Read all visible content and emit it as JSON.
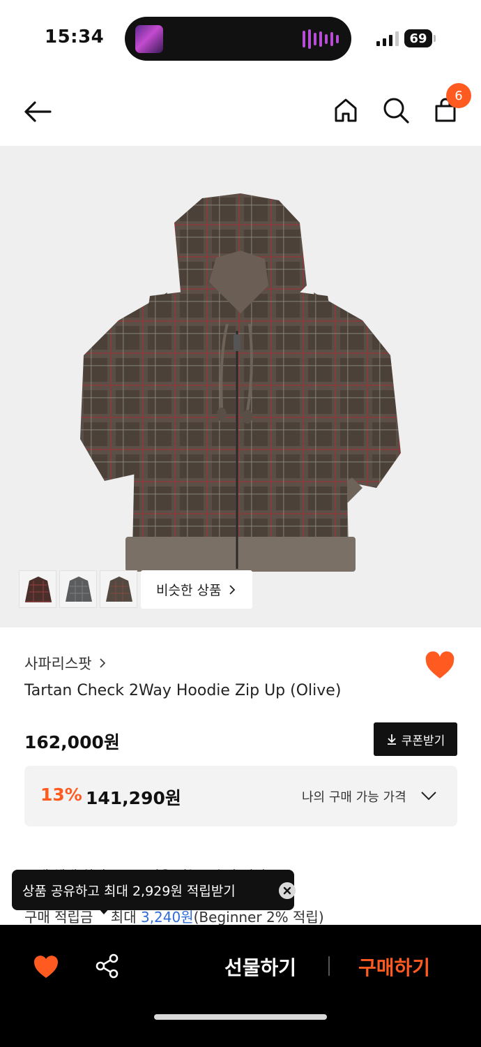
{
  "status": {
    "time": "15:34",
    "battery": "69"
  },
  "nav": {
    "cart_count": "6"
  },
  "gallery": {
    "similar_label": "비슷한 상품"
  },
  "product": {
    "brand": "사파리스팟",
    "title": "Tartan Check 2Way Hoodie Zip Up (Olive)",
    "price": "162,000원",
    "coupon_label": "쿠폰받기",
    "discount_rate": "13%",
    "discount_price": "141,290원",
    "my_price_label": "나의 구매 가능 가격",
    "liked": true
  },
  "benefits": {
    "row1": "구매 혜택    회원 등급 · 적용 가능 · 추가 적립",
    "row2_label": "구매 적립금",
    "row2_prefix": "최대 ",
    "row2_amount": "3,240원",
    "row2_suffix": "(Beginner 2% 적립)"
  },
  "toast": {
    "text": "상품 공유하고 최대 2,929원 적립받기"
  },
  "action_bar": {
    "gift_label": "선물하기",
    "buy_label": "구매하기"
  },
  "colors": {
    "accent": "#ff5a1f",
    "link_blue": "#2f6bd8",
    "jacket_olive": "#4a4038"
  }
}
